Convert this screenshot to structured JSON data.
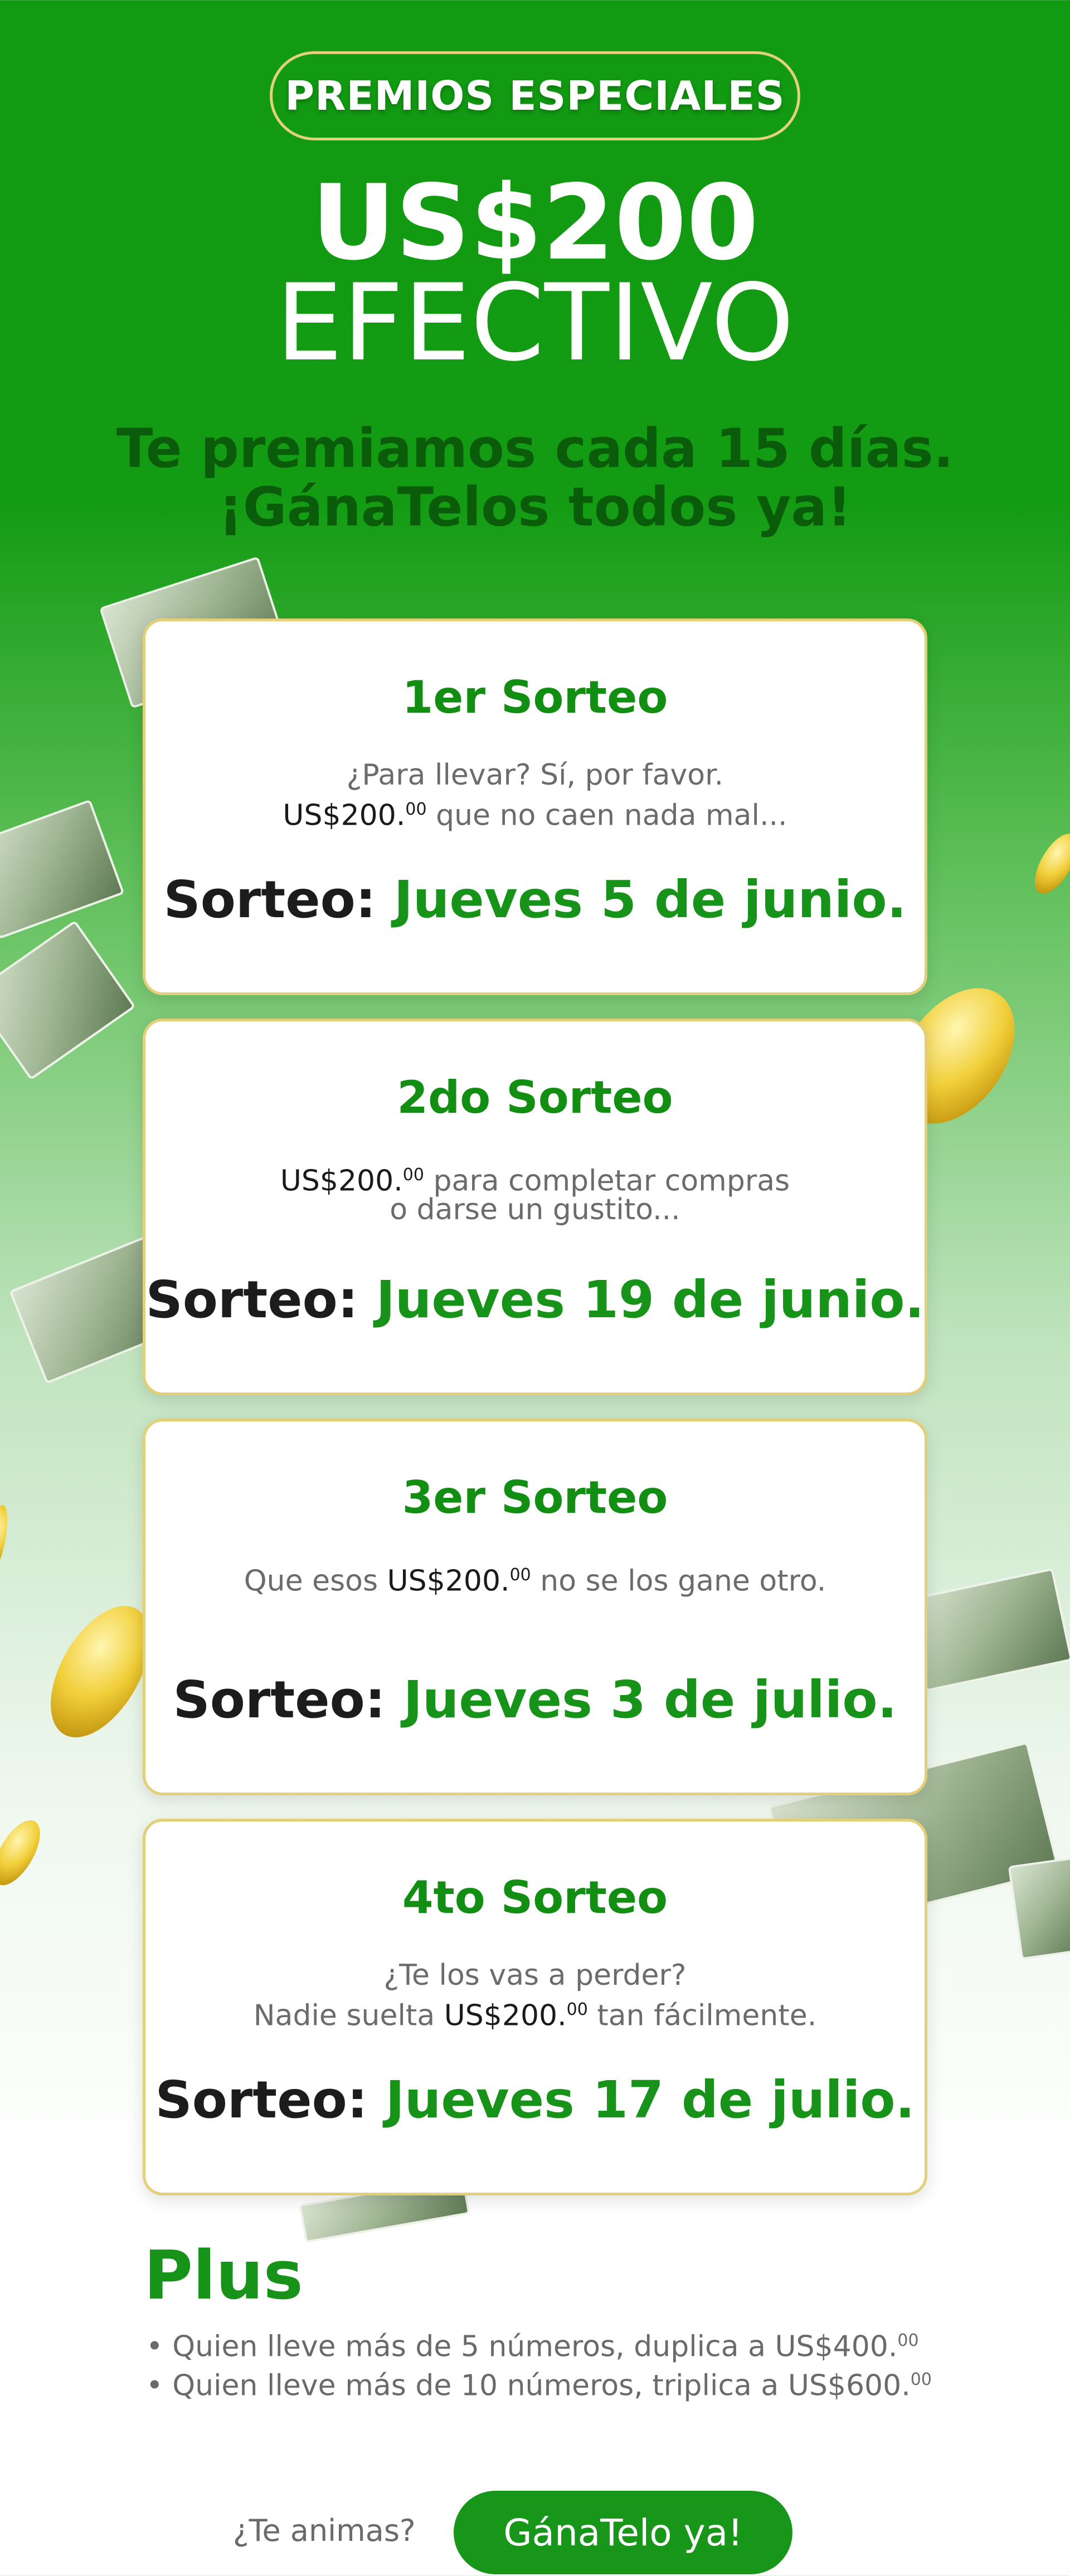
{
  "header": {
    "badge": "PREMIOS ESPECIALES",
    "amount": "US$200",
    "cash_word": "EFECTIVO",
    "tagline_1": "Te premiamos cada 15 días.",
    "tagline_2": "¡GánaTelos todos ya!"
  },
  "draws": [
    {
      "title": "1er Sorteo",
      "line1": "¿Para llevar? Sí, por favor.",
      "line2_amount": "US$200.",
      "line2_cents": "00",
      "line2_text": " que no caen nada mal...",
      "label": "Sorteo: ",
      "date": "Jueves 5 de junio."
    },
    {
      "title": "2do Sorteo",
      "line1_amount": "US$200.",
      "line1_cents": "00",
      "line1_text": " para completar compras",
      "line2": "o darse un gustito...",
      "label": "Sorteo: ",
      "date": "Jueves 19 de junio."
    },
    {
      "title": "3er Sorteo",
      "line1_pre": "Que esos ",
      "line1_amount": "US$200.",
      "line1_cents": "00",
      "line1_text": " no se los gane otro.",
      "label": "Sorteo: ",
      "date": "Jueves 3 de julio."
    },
    {
      "title": "4to Sorteo",
      "line1": "¿Te los vas a perder?",
      "line2_pre": "Nadie suelta ",
      "line2_amount": "US$200.",
      "line2_cents": "00",
      "line2_text": " tan fácilmente.",
      "label": "Sorteo: ",
      "date": "Jueves 17 de julio."
    }
  ],
  "plus": {
    "title": "Plus",
    "items": [
      {
        "text": "• Quien lleve más de 5 números, duplica a US$400.",
        "cents": "00"
      },
      {
        "text": "• Quien lleve más de 10 números, triplica a US$600.",
        "cents": "00"
      }
    ]
  },
  "footer": {
    "question": "¿Te animas?",
    "cta": "GánaTelo ya!"
  },
  "colors": {
    "brand_green": "#18931a",
    "gold_border": "#e2cf78"
  }
}
